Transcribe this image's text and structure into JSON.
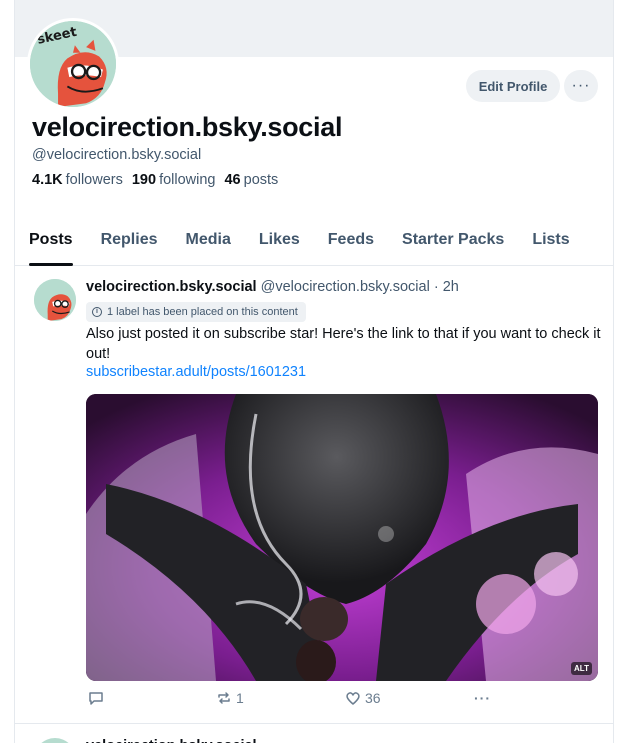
{
  "profile": {
    "display_name": "velocirection.bsky.social",
    "handle": "@velocirection.bsky.social",
    "followers_count": "4.1K",
    "followers_label": "followers",
    "following_count": "190",
    "following_label": "following",
    "posts_count": "46",
    "posts_label": "posts",
    "avatar_text": "skeet",
    "edit_label": "Edit Profile",
    "more_label": "···"
  },
  "tabs": [
    "Posts",
    "Replies",
    "Media",
    "Likes",
    "Feeds",
    "Starter Packs",
    "Lists"
  ],
  "active_tab": "Posts",
  "post": {
    "author_name": "velocirection.bsky.social",
    "author_handle": "@velocirection.bsky.social",
    "separator": "·",
    "time": "2h",
    "label_notice": "1 label has been placed on this content",
    "text": "Also just posted it on subscribe star! Here's the link to that if you want to check it out!",
    "link": "subscribestar.adult/posts/1601231",
    "alt_badge": "ALT",
    "reply_count": "",
    "repost_count": "1",
    "like_count": "36"
  },
  "icons": {
    "reply": "reply-icon",
    "repost": "repost-icon",
    "like": "heart-icon",
    "more": "more-icon",
    "info": "info-icon"
  },
  "colors": {
    "link": "#1083fe",
    "muted": "#42576c",
    "banner": "#eef1f4",
    "avatar_bg": "#b6dccf"
  }
}
